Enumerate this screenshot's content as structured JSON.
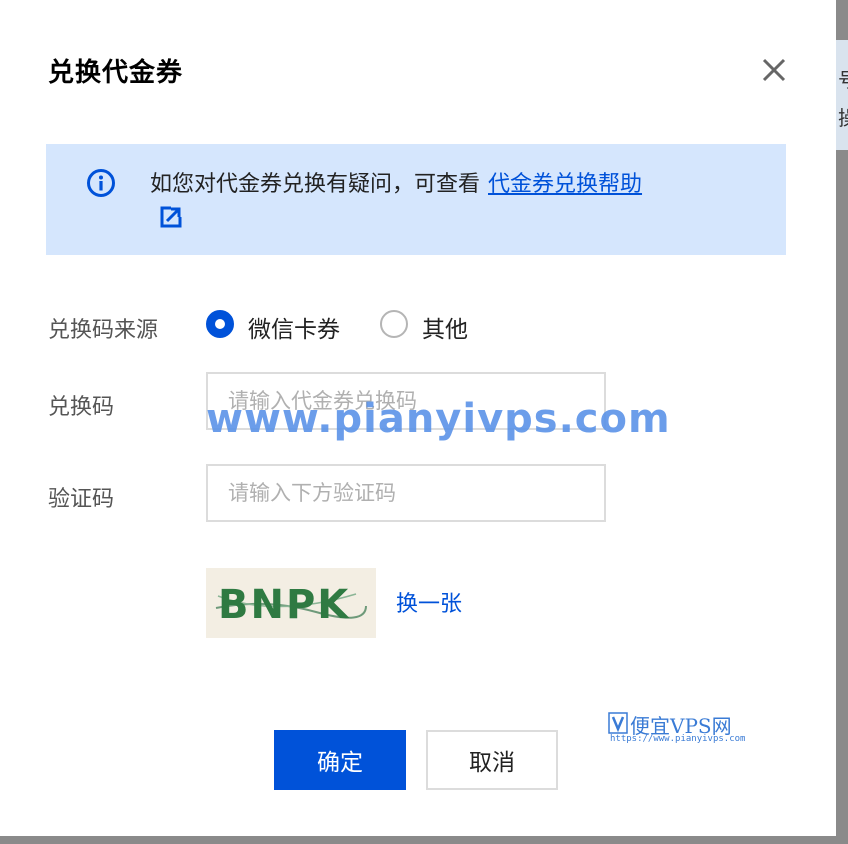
{
  "dialog": {
    "title": "兑换代金券",
    "notice": {
      "text": "如您对代金券兑换有疑问，可查看",
      "link": "代金券兑换帮助"
    },
    "source": {
      "label": "兑换码来源",
      "options": [
        "微信卡券",
        "其他"
      ],
      "selected": "微信卡券"
    },
    "code": {
      "label": "兑换码",
      "placeholder": "请输入代金券兑换码"
    },
    "verify": {
      "label": "验证码",
      "placeholder": "请输入下方验证码",
      "captcha_text": "BNPK",
      "refresh_label": "换一张"
    },
    "buttons": {
      "confirm": "确定",
      "cancel": "取消"
    }
  },
  "background": {
    "edge_chars": [
      "号",
      "操"
    ]
  },
  "watermark": {
    "url_text": "www.pianyivps.com",
    "logo_title": "便宜VPS网",
    "logo_url": "https://www.pianyivps.com"
  },
  "colors": {
    "primary": "#0052d9",
    "notice_bg": "#d5e6fd",
    "watermark": "#5b93e8"
  },
  "icons": [
    "close-icon",
    "info-icon",
    "external-link-icon"
  ]
}
